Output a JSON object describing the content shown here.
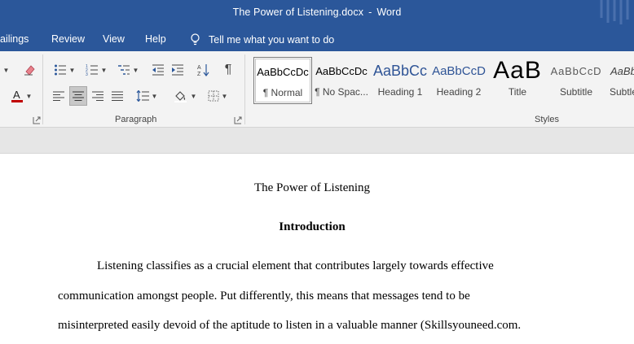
{
  "window": {
    "file_name": "The Power of Listening.docx",
    "separator": "-",
    "app_name": "Word"
  },
  "tabs": {
    "mailings": "ailings",
    "review": "Review",
    "view": "View",
    "help": "Help",
    "tell_me": "Tell me what you want to do"
  },
  "ribbon": {
    "paragraph_label": "Paragraph",
    "styles_label": "Styles",
    "font_color": "#c00000",
    "accent": "#2b579a"
  },
  "styles": [
    {
      "preview": "AaBbCcDc",
      "name": "¶ Normal",
      "selected": true
    },
    {
      "preview": "AaBbCcDc",
      "name": "¶ No Spac..."
    },
    {
      "preview": "AaBbCc",
      "name": "Heading 1"
    },
    {
      "preview": "AaBbCcD",
      "name": "Heading 2"
    },
    {
      "preview": "AaB",
      "name": "Title"
    },
    {
      "preview": "AaBbCcD",
      "name": "Subtitle"
    },
    {
      "preview": "AaBbCcD",
      "name": "Subtle"
    }
  ],
  "document": {
    "title": "The Power of Listening",
    "heading": "Introduction",
    "lines": [
      "Listening classifies as a crucial element that contributes largely towards effective",
      "communication amongst people. Put differently, this means that messages tend to be",
      "misinterpreted easily devoid of the aptitude to listen in a valuable manner (Skillsyouneed.com."
    ]
  }
}
